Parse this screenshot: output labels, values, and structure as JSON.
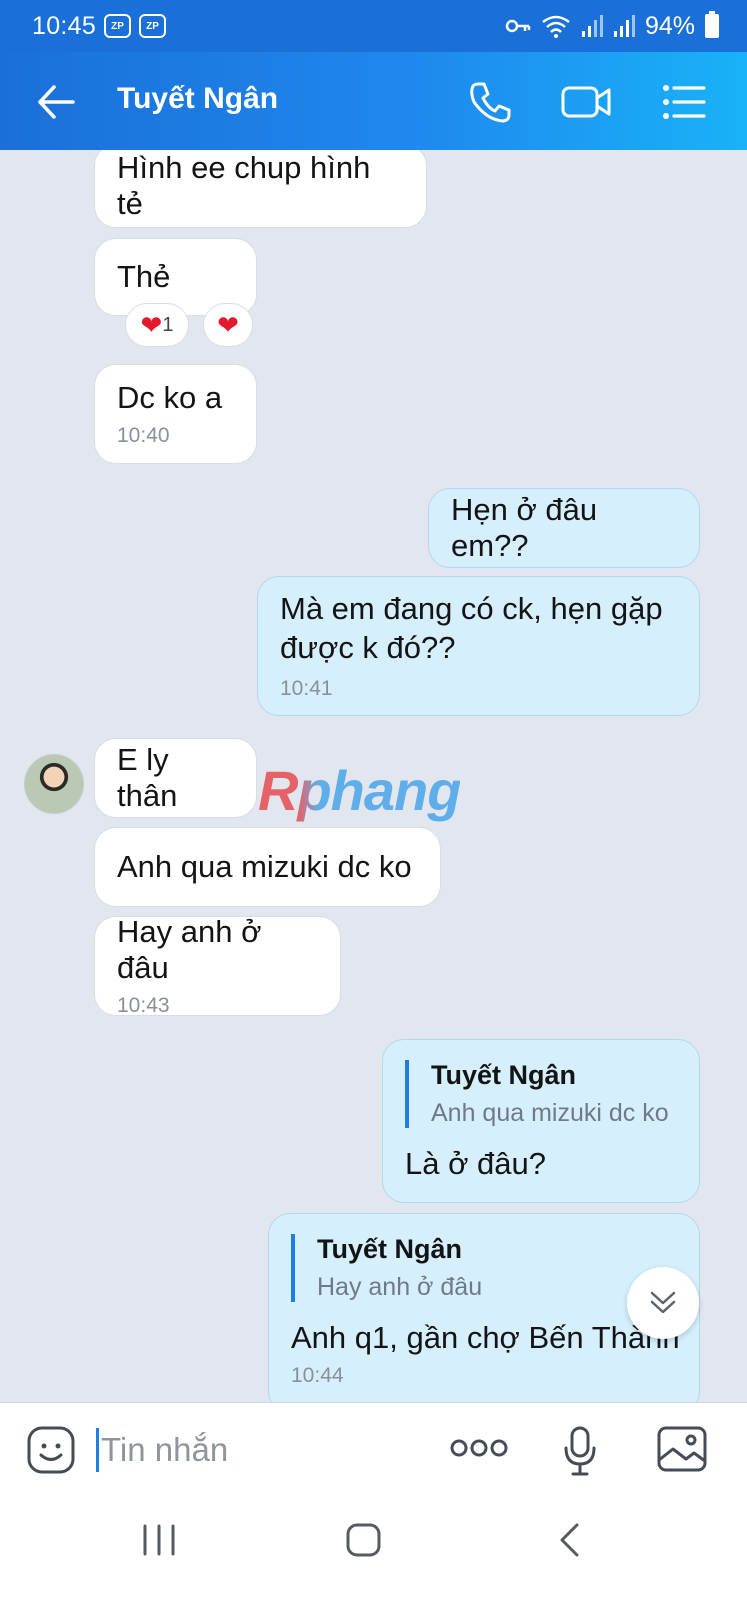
{
  "status_bar": {
    "time": "10:45",
    "badges": [
      "ZP",
      "ZP"
    ],
    "battery": "94%"
  },
  "header": {
    "title": "Tuyết Ngân",
    "icons": [
      "back-arrow-icon",
      "phone-icon",
      "video-call-icon",
      "menu-list-icon"
    ]
  },
  "messages": [
    {
      "side": "in",
      "text": "Hình ee chup hình tẻ"
    },
    {
      "side": "in",
      "text": "Thẻ",
      "reactions": {
        "count": "1"
      }
    },
    {
      "side": "in",
      "text": "Dc ko a",
      "time": "10:40"
    },
    {
      "side": "out",
      "text": "Hẹn ở đâu em??"
    },
    {
      "side": "out",
      "text": "Mà em đang có ck, hẹn gặp được k đó??",
      "time": "10:41"
    },
    {
      "side": "in",
      "text": "E ly thân"
    },
    {
      "side": "in",
      "text": "Anh qua mizuki dc ko"
    },
    {
      "side": "in",
      "text": "Hay anh ở đâu",
      "time": "10:43"
    },
    {
      "side": "out",
      "quote_name": "Tuyết Ngân",
      "quote_text": "Anh qua mizuki dc ko",
      "text": "Là ở đâu?"
    },
    {
      "side": "out",
      "quote_name": "Tuyết Ngân",
      "quote_text": "Hay anh ở đâu",
      "text": "Anh q1, gần chợ Bến Thành",
      "time": "10:44"
    }
  ],
  "watermark": "Rphang",
  "input": {
    "placeholder": "Tin nhắn"
  },
  "colors": {
    "header_start": "#1b6fd9",
    "header_end": "#19b2f8",
    "chat_bg": "#e2e7ef",
    "outgoing_bubble": "#d6effd",
    "incoming_bubble": "#ffffff",
    "accent": "#1e7ee8"
  }
}
